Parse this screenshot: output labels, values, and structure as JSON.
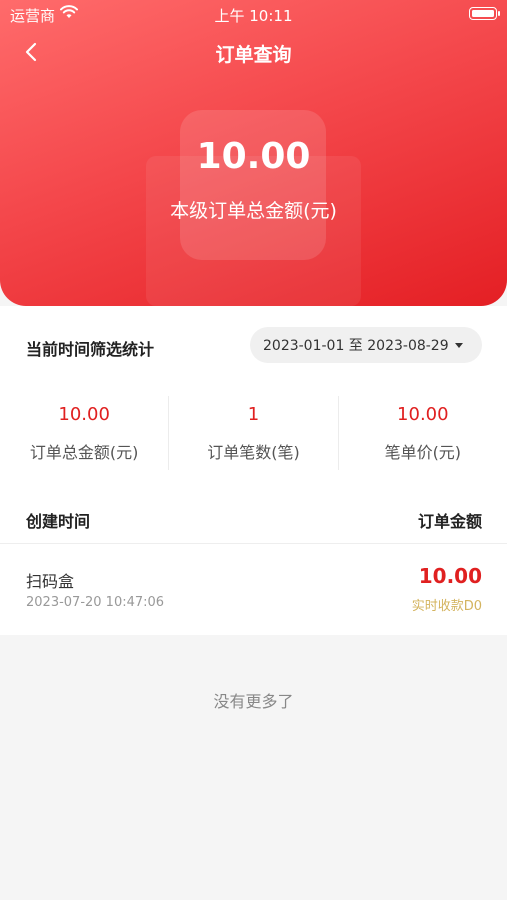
{
  "status_bar": {
    "carrier": "运营商",
    "time": "上午 10:11"
  },
  "header": {
    "title": "订单查询"
  },
  "summary": {
    "total_value": "10.00",
    "total_label": "本级订单总金额(元)"
  },
  "filter": {
    "title": "当前时间筛选统计",
    "date_range": "2023-01-01 至 2023-08-29"
  },
  "stats": [
    {
      "value": "10.00",
      "label": "订单总金额(元)"
    },
    {
      "value": "1",
      "label": "订单笔数(笔)"
    },
    {
      "value": "10.00",
      "label": "笔单价(元)"
    }
  ],
  "list": {
    "header_left": "创建时间",
    "header_right": "订单金额",
    "rows": [
      {
        "name": "扫码盒",
        "time": "2023-07-20 10:47:06",
        "amount": "10.00",
        "status": "实时收款D0"
      }
    ]
  },
  "footer": {
    "no_more": "没有更多了"
  },
  "colors": {
    "accent": "#e02020",
    "hero_start": "#ff6b6b",
    "hero_end": "#e41f24",
    "status_gold": "#d4b45f"
  }
}
